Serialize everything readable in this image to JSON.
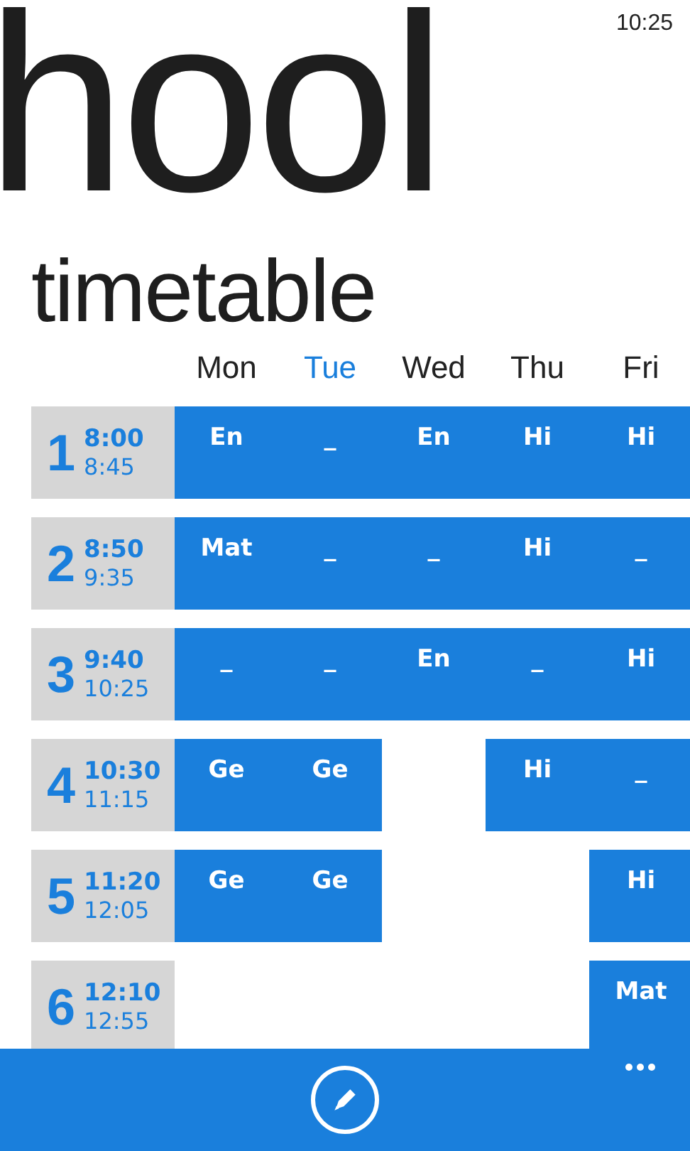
{
  "status_bar": {
    "time": "10:25"
  },
  "header": {
    "title": "hool",
    "subtitle": "timetable"
  },
  "days": [
    {
      "label": "Mon",
      "selected": false
    },
    {
      "label": "Tue",
      "selected": true
    },
    {
      "label": "Wed",
      "selected": false
    },
    {
      "label": "Thu",
      "selected": false
    },
    {
      "label": "Fri",
      "selected": false
    }
  ],
  "periods": [
    {
      "number": "1",
      "start": "8:00",
      "end": "8:45",
      "cells": [
        {
          "kind": "lesson",
          "text": "En"
        },
        {
          "kind": "lesson",
          "text": "_"
        },
        {
          "kind": "lesson",
          "text": "En"
        },
        {
          "kind": "lesson",
          "text": "Hi"
        },
        {
          "kind": "lesson",
          "text": "Hi"
        }
      ]
    },
    {
      "number": "2",
      "start": "8:50",
      "end": "9:35",
      "cells": [
        {
          "kind": "lesson",
          "text": "Mat"
        },
        {
          "kind": "lesson",
          "text": "_"
        },
        {
          "kind": "lesson",
          "text": "_"
        },
        {
          "kind": "lesson",
          "text": "Hi"
        },
        {
          "kind": "lesson",
          "text": "_"
        }
      ]
    },
    {
      "number": "3",
      "start": "9:40",
      "end": "10:25",
      "cells": [
        {
          "kind": "lesson",
          "text": "_"
        },
        {
          "kind": "lesson",
          "text": "_"
        },
        {
          "kind": "lesson",
          "text": "En"
        },
        {
          "kind": "lesson",
          "text": "_"
        },
        {
          "kind": "lesson",
          "text": "Hi"
        }
      ]
    },
    {
      "number": "4",
      "start": "10:30",
      "end": "11:15",
      "cells": [
        {
          "kind": "lesson",
          "text": "Ge"
        },
        {
          "kind": "lesson",
          "text": "Ge"
        },
        {
          "kind": "empty"
        },
        {
          "kind": "lesson",
          "text": "Hi"
        },
        {
          "kind": "lesson",
          "text": "_"
        }
      ]
    },
    {
      "number": "5",
      "start": "11:20",
      "end": "12:05",
      "cells": [
        {
          "kind": "lesson",
          "text": "Ge"
        },
        {
          "kind": "lesson",
          "text": "Ge"
        },
        {
          "kind": "empty"
        },
        {
          "kind": "empty"
        },
        {
          "kind": "lesson",
          "text": "Hi"
        }
      ]
    },
    {
      "number": "6",
      "start": "12:10",
      "end": "12:55",
      "cells": [
        {
          "kind": "empty"
        },
        {
          "kind": "empty"
        },
        {
          "kind": "empty"
        },
        {
          "kind": "empty"
        },
        {
          "kind": "lesson",
          "text": "Mat"
        }
      ]
    }
  ]
}
